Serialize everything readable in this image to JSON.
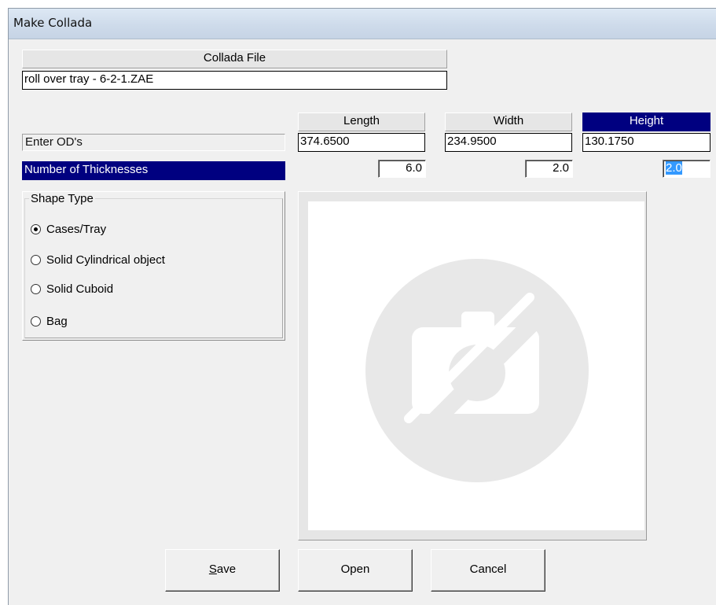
{
  "window": {
    "title": "Make Collada"
  },
  "collada": {
    "header": "Collada File",
    "file_name": "roll over tray - 6-2-1.ZAE"
  },
  "dimensions": {
    "label": "Enter OD's",
    "length_header": "Length",
    "width_header": "Width",
    "height_header": "Height",
    "length_value": "374.6500",
    "width_value": "234.9500",
    "height_value": "130.1750"
  },
  "thickness": {
    "label": "Number of Thicknesses",
    "length_value": "6.0",
    "width_value": "2.0",
    "height_value": "2.0"
  },
  "shape_type": {
    "title": "Shape Type",
    "options": [
      "Cases/Tray",
      "Solid Cylindrical object",
      "Solid Cuboid",
      "Bag"
    ],
    "selected": "Cases/Tray"
  },
  "preview": {
    "icon": "camera-off-icon"
  },
  "buttons": {
    "save_prefix": "S",
    "save_rest": "ave",
    "open": "Open",
    "cancel": "Cancel"
  },
  "colors": {
    "selection": "#000080",
    "highlight": "#3399ff"
  }
}
